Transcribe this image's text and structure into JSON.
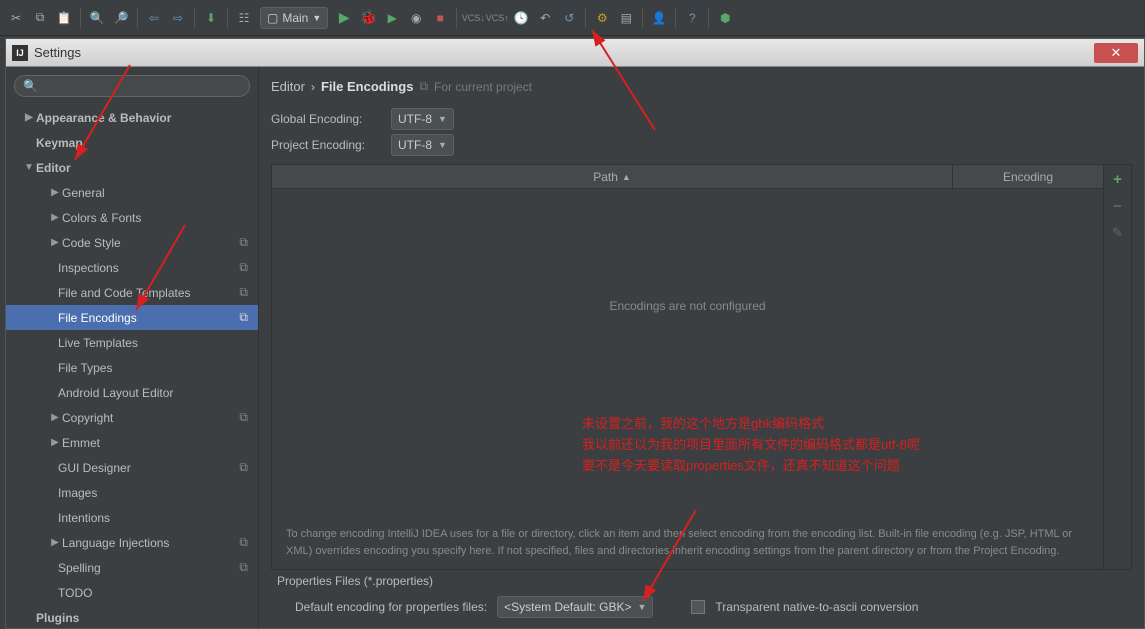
{
  "toolbar": {
    "run_config": "Main"
  },
  "window": {
    "title": "Settings"
  },
  "search": {
    "placeholder": ""
  },
  "tree": {
    "appearance": "Appearance & Behavior",
    "keymap": "Keymap",
    "editor": "Editor",
    "general": "General",
    "colors": "Colors & Fonts",
    "codestyle": "Code Style",
    "inspections": "Inspections",
    "file_templates": "File and Code Templates",
    "file_encodings": "File Encodings",
    "live_templates": "Live Templates",
    "file_types": "File Types",
    "android_layout": "Android Layout Editor",
    "copyright": "Copyright",
    "emmet": "Emmet",
    "gui_designer": "GUI Designer",
    "images": "Images",
    "intentions": "Intentions",
    "lang_injections": "Language Injections",
    "spelling": "Spelling",
    "todo": "TODO",
    "plugins": "Plugins"
  },
  "breadcrumb": {
    "editor": "Editor",
    "file_encodings": "File Encodings",
    "hint": "For current project"
  },
  "fields": {
    "global_label": "Global Encoding:",
    "global_value": "UTF-8",
    "project_label": "Project Encoding:",
    "project_value": "UTF-8"
  },
  "table": {
    "col_path": "Path",
    "col_encoding": "Encoding",
    "empty": "Encodings are not configured"
  },
  "help": "To change encoding IntelliJ IDEA uses for a file or directory, click an item and then select encoding from the encoding list. Built-in file encoding (e.g. JSP, HTML or XML) overrides encoding you specify here. If not specified, files and directories inherit encoding settings from the parent directory or from the Project Encoding.",
  "props": {
    "section": "Properties Files (*.properties)",
    "label": "Default encoding for properties files:",
    "value": "<System Default: GBK>",
    "checkbox_label": "Transparent native-to-ascii conversion"
  },
  "annotation": {
    "line1": "未设置之前，我的这个地方是gbk编码格式",
    "line2": "我以前还以为我的项目里面所有文件的编码格式都是utf-8呢",
    "line3": "要不是今天要读取properties文件，还真不知道这个问题"
  }
}
